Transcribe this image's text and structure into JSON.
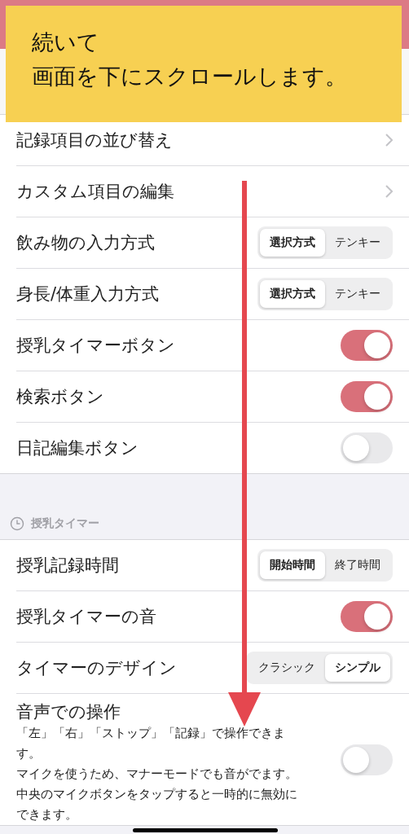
{
  "callout": {
    "lines": [
      "続いて",
      "画面を下にスクロールします。"
    ]
  },
  "sections": [
    {
      "rows": [
        {
          "kind": "link",
          "label": "記録項目の並び替え"
        },
        {
          "kind": "link",
          "label": "カスタム項目の編集"
        },
        {
          "kind": "segmented",
          "label": "飲み物の入力方式",
          "options": [
            {
              "label": "選択方式",
              "selected": true
            },
            {
              "label": "テンキー",
              "selected": false
            }
          ]
        },
        {
          "kind": "segmented",
          "label": "身長/体重入力方式",
          "options": [
            {
              "label": "選択方式",
              "selected": true
            },
            {
              "label": "テンキー",
              "selected": false
            }
          ]
        },
        {
          "kind": "toggle",
          "label": "授乳タイマーボタン",
          "on": true
        },
        {
          "kind": "toggle",
          "label": "検索ボタン",
          "on": true
        },
        {
          "kind": "toggle",
          "label": "日記編集ボタン",
          "on": false
        }
      ]
    },
    {
      "header": "授乳タイマー",
      "rows": [
        {
          "kind": "segmented",
          "label": "授乳記録時間",
          "options": [
            {
              "label": "開始時間",
              "selected": true
            },
            {
              "label": "終了時間",
              "selected": false
            }
          ]
        },
        {
          "kind": "toggle",
          "label": "授乳タイマーの音",
          "on": true
        },
        {
          "kind": "segmented",
          "label": "タイマーのデザイン",
          "options": [
            {
              "label": "クラシック",
              "selected": false
            },
            {
              "label": "シンプル",
              "selected": true
            }
          ]
        },
        {
          "kind": "toggle",
          "label": "音声での操作",
          "note": [
            "「左」「右」「ストップ」「記録」で操作できます。",
            "マイクを使うため、マナーモードでも音がでます。",
            "中央のマイクボタンをタップすると一時的に無効にできます。"
          ],
          "on": false
        }
      ]
    }
  ]
}
